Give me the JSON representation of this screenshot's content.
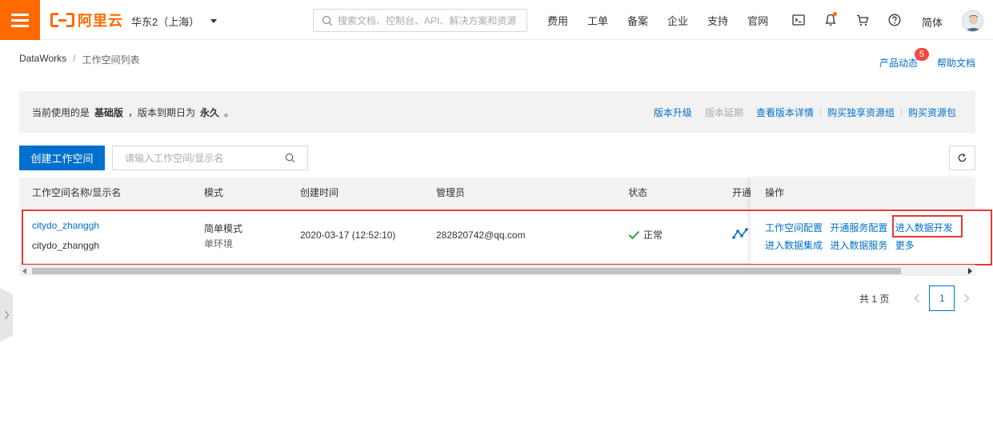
{
  "header": {
    "logo_text": "阿里云",
    "region": "华东2（上海）",
    "search_placeholder": "搜索文档、控制台、API、解决方案和资源",
    "nav": [
      "费用",
      "工单",
      "备案",
      "企业",
      "支持",
      "官网"
    ],
    "lang": "简体"
  },
  "breadcrumb": {
    "root": "DataWorks",
    "sep": "/",
    "current": "工作空间列表"
  },
  "top_links": {
    "product_news": "产品动态",
    "product_news_badge": "5",
    "help_docs": "帮助文档"
  },
  "banner": {
    "prefix": "当前使用的是",
    "edition": "基础版",
    "middle": "，版本到期日为",
    "expiry": "永久",
    "suffix": "。",
    "links": {
      "upgrade": "版本升级",
      "extend": "版本延期",
      "details": "查看版本详情",
      "buy_exclusive": "购买独享资源组",
      "buy_package": "购买资源包"
    }
  },
  "toolbar": {
    "create_label": "创建工作空间",
    "search_placeholder": "请输入工作空间/显示名"
  },
  "table": {
    "columns": [
      "工作空间名称/显示名",
      "模式",
      "创建时间",
      "管理员",
      "状态",
      "开通",
      "操作"
    ],
    "rows": [
      {
        "name": "citydo_zhanggh",
        "display_name": "citydo_zhanggh",
        "mode": "简单模式",
        "env": "单环境",
        "created": "2020-03-17 (12:52:10)",
        "admin": "282820742@qq.com",
        "status": "正常",
        "actions": [
          "工作空间配置",
          "开通服务配置",
          "进入数据开发",
          "进入数据集成",
          "进入数据服务",
          "更多"
        ]
      }
    ]
  },
  "pagination": {
    "total": "共 1 页",
    "current": "1"
  },
  "colors": {
    "brand": "#ff6a00",
    "primary": "#0070cc",
    "success": "#2ca02c",
    "highlight": "#e53935"
  }
}
